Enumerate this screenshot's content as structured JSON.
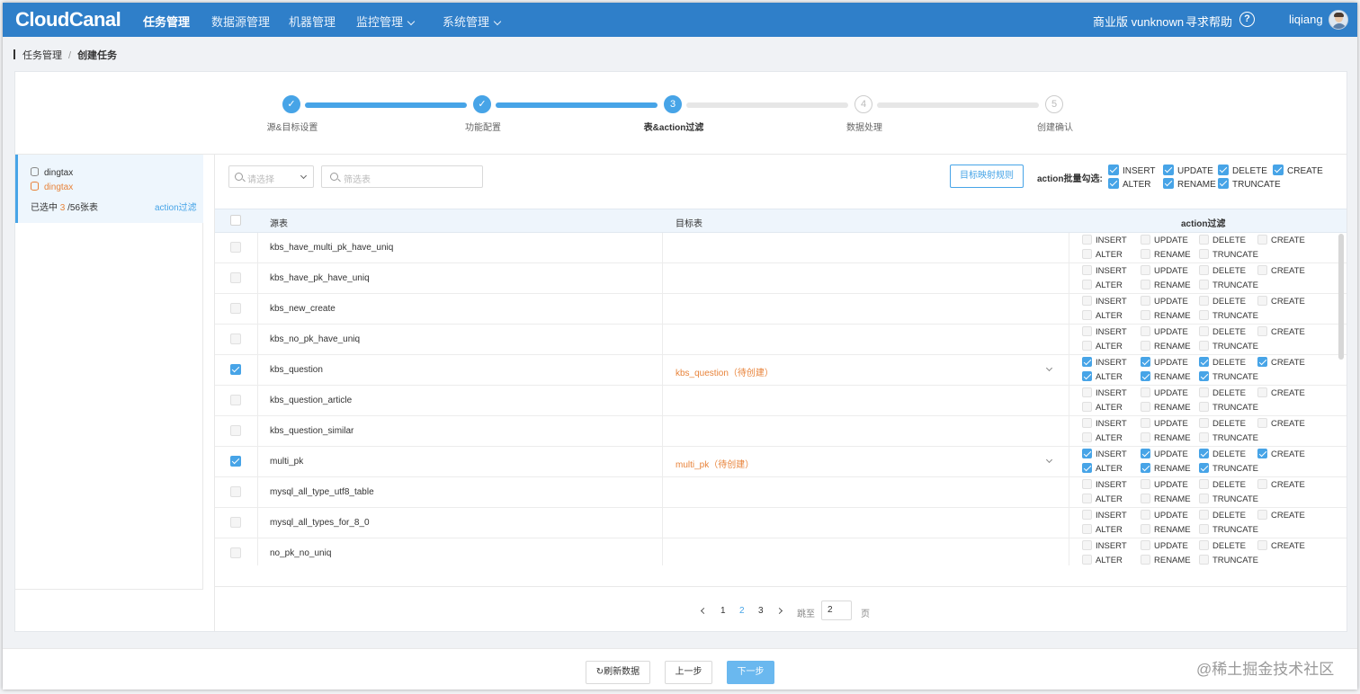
{
  "header": {
    "logo": "CloudCanal",
    "nav": [
      "任务管理",
      "数据源管理",
      "机器管理",
      "监控管理",
      "系统管理"
    ],
    "edition": "商业版 vunknown",
    "help": "寻求帮助",
    "help_icon": "?",
    "user": "liqiang"
  },
  "breadcrumb": {
    "parent": "任务管理",
    "sep": "/",
    "current": "创建任务"
  },
  "steps": [
    {
      "label": "源&目标设置",
      "num": "✓",
      "state": "done"
    },
    {
      "label": "功能配置",
      "num": "✓",
      "state": "done"
    },
    {
      "label": "表&action过滤",
      "num": "3",
      "state": "active"
    },
    {
      "label": "数据处理",
      "num": "4",
      "state": "todo"
    },
    {
      "label": "创建确认",
      "num": "5",
      "state": "todo"
    }
  ],
  "source": {
    "db_name": "dingtax",
    "target_name": "dingtax",
    "selected_prefix": "已选中",
    "selected_count": "3",
    "selected_suffix": "/56张表",
    "action_link": "action过滤"
  },
  "toolbar": {
    "select_placeholder": "请选择",
    "filter_placeholder": "筛选表",
    "rule_button": "目标映射规则",
    "batch_label": "action批量勾选:",
    "batch_actions": [
      "INSERT",
      "UPDATE",
      "DELETE",
      "CREATE",
      "ALTER",
      "RENAME",
      "TRUNCATE"
    ]
  },
  "table": {
    "headers": {
      "source": "源表",
      "target": "目标表",
      "action": "action过滤"
    },
    "actions_top": [
      "INSERT",
      "UPDATE",
      "DELETE",
      "CREATE"
    ],
    "actions_bottom": [
      "ALTER",
      "RENAME",
      "TRUNCATE"
    ],
    "rows": [
      {
        "source": "kbs_have_multi_pk_have_uniq",
        "target": "",
        "checked": false
      },
      {
        "source": "kbs_have_pk_have_uniq",
        "target": "",
        "checked": false
      },
      {
        "source": "kbs_new_create",
        "target": "",
        "checked": false
      },
      {
        "source": "kbs_no_pk_have_uniq",
        "target": "",
        "checked": false
      },
      {
        "source": "kbs_question",
        "target": "kbs_question（待创建）",
        "checked": true
      },
      {
        "source": "kbs_question_article",
        "target": "",
        "checked": false
      },
      {
        "source": "kbs_question_similar",
        "target": "",
        "checked": false
      },
      {
        "source": "multi_pk",
        "target": "multi_pk（待创建）",
        "checked": true
      },
      {
        "source": "mysql_all_type_utf8_table",
        "target": "",
        "checked": false
      },
      {
        "source": "mysql_all_types_for_8_0",
        "target": "",
        "checked": false
      },
      {
        "source": "no_pk_no_uniq",
        "target": "",
        "checked": false
      }
    ]
  },
  "pagination": {
    "pages": [
      "1",
      "2",
      "3"
    ],
    "current": "2",
    "jump_label": "跳至",
    "jump_value": "2",
    "page_unit": "页"
  },
  "footer": {
    "refresh": "↻刷新数据",
    "prev": "上一步",
    "next": "下一步"
  },
  "watermark": "@稀土掘金技术社区",
  "colors": {
    "topbar": "#2f7fc9",
    "accent": "#47a4e7",
    "orange": "#e8833a"
  }
}
